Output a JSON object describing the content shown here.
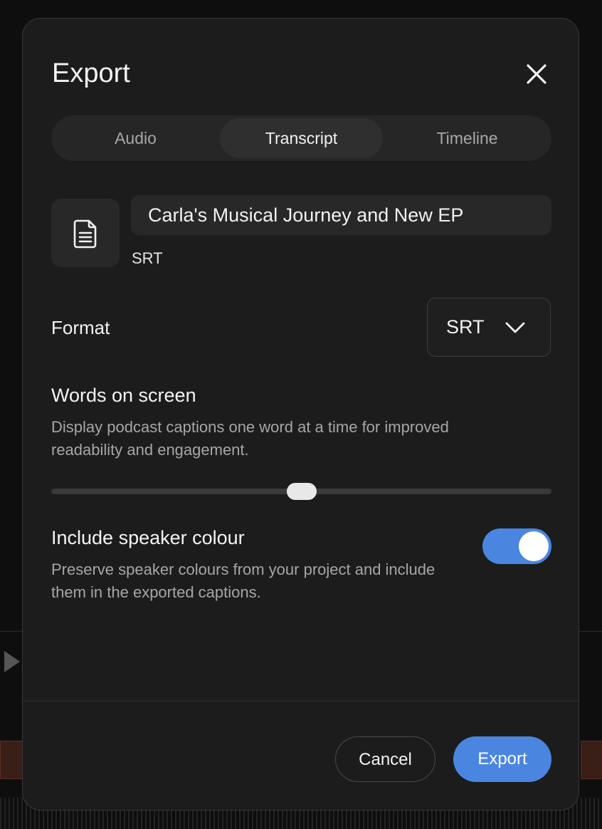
{
  "dialog": {
    "title": "Export",
    "tabs": [
      {
        "label": "Audio",
        "active": false
      },
      {
        "label": "Transcript",
        "active": true
      },
      {
        "label": "Timeline",
        "active": false
      }
    ],
    "file": {
      "icon": "document-icon",
      "name": "Carla's Musical Journey and New EP",
      "type": "SRT"
    },
    "format": {
      "label": "Format",
      "selected": "SRT"
    },
    "words_on_screen": {
      "title": "Words on screen",
      "description": "Display podcast captions one word at a time for improved readability and engagement.",
      "slider_fraction": 0.5
    },
    "speaker_colour": {
      "title": "Include speaker colour",
      "description": "Preserve speaker colours from your project and include them in the exported captions.",
      "enabled": true
    },
    "buttons": {
      "cancel": "Cancel",
      "export": "Export"
    }
  },
  "colors": {
    "accent": "#4a86e0",
    "modal_bg": "#1c1c1c",
    "clip_bg": "#3a1f19"
  }
}
